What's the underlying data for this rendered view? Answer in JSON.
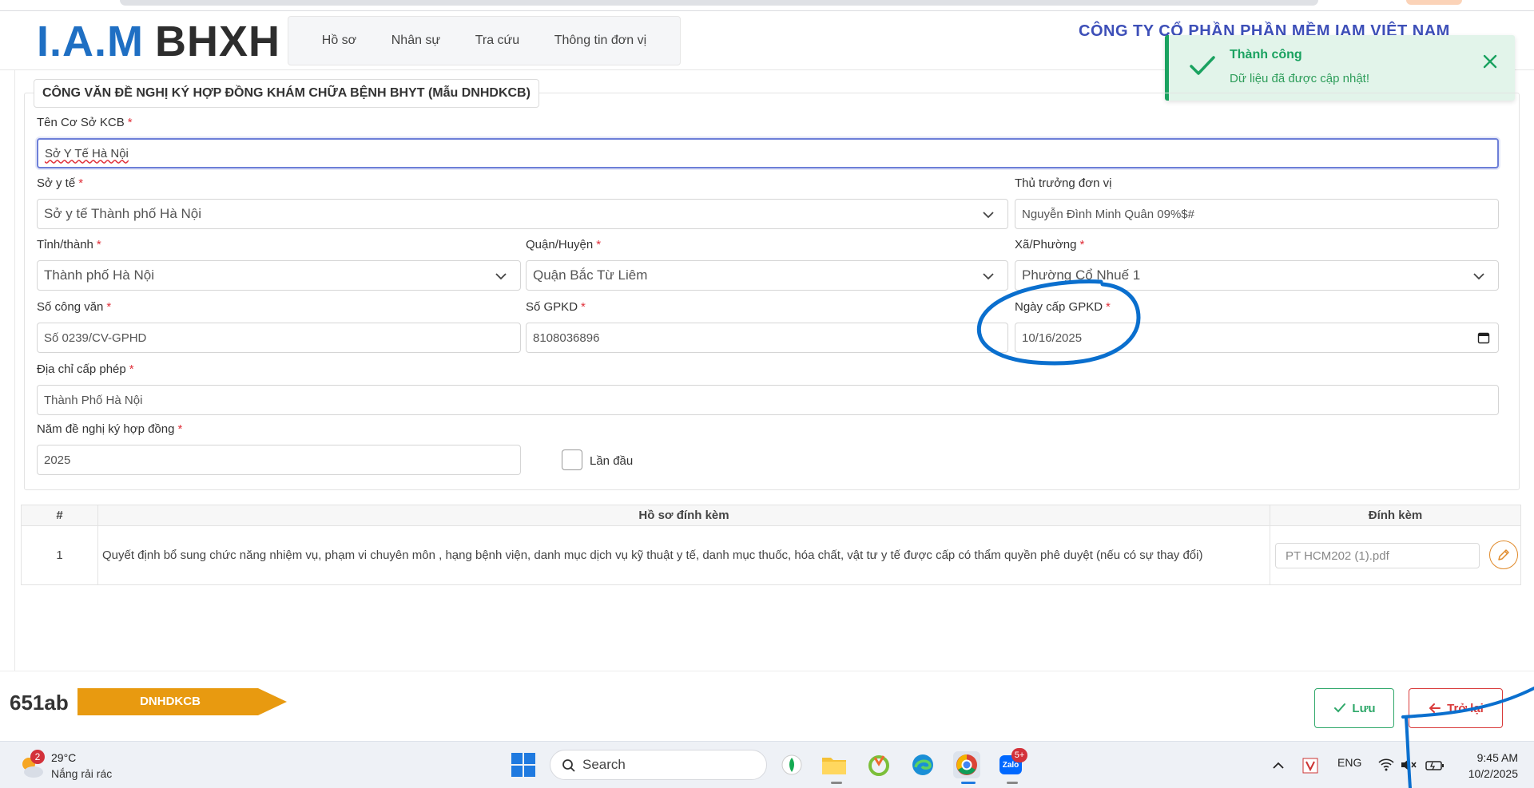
{
  "header": {
    "logo_iam": "I.A.M",
    "logo_bhxh": "BHXH",
    "nav": [
      "Hồ sơ",
      "Nhân sự",
      "Tra cứu",
      "Thông tin đơn vị"
    ],
    "company": "CÔNG TY CỔ PHẦN PHẦN MỀM IAM VIỆT NAM"
  },
  "toast": {
    "title": "Thành công",
    "message": "Dữ liệu đã được cập nhật!"
  },
  "form": {
    "legend": "CÔNG VĂN ĐỀ NGHỊ KÝ HỢP ĐỒNG KHÁM CHỮA BỆNH BHYT (Mẫu DNHDKCB)",
    "ten_co_so": {
      "label": "Tên Cơ Sở KCB",
      "value": "Sở Y Tế Hà Nội"
    },
    "so_y_te": {
      "label": "Sở y tế",
      "value": "Sở y tế Thành phố Hà Nội"
    },
    "thu_truong": {
      "label": "Thủ trưởng đơn vị",
      "value": "Nguyễn Đình Minh Quân 09%$#"
    },
    "tinh_thanh": {
      "label": "Tỉnh/thành",
      "value": "Thành phố Hà Nội"
    },
    "quan_huyen": {
      "label": "Quận/Huyện",
      "value": "Quận Bắc Từ Liêm"
    },
    "xa_phuong": {
      "label": "Xã/Phường",
      "value": "Phường Cổ Nhuế 1"
    },
    "so_cong_van": {
      "label": "Số công văn",
      "value": "Số 0239/CV-GPHD"
    },
    "so_gpkd": {
      "label": "Số GPKD",
      "value": "8108036896"
    },
    "ngay_cap": {
      "label": "Ngày cấp GPKD",
      "value": "10/16/2025"
    },
    "dia_chi": {
      "label": "Địa chỉ cấp phép",
      "value": "Thành Phố Hà Nội"
    },
    "nam_de_nghi": {
      "label": "Năm đề nghị ký hợp đồng",
      "value": "2025"
    },
    "lan_dau": {
      "label": "Lần đầu",
      "checked": false
    },
    "required_mark": "*"
  },
  "attachments": {
    "headers": [
      "#",
      "Hồ sơ đính kèm",
      "Đính kèm"
    ],
    "rows": [
      {
        "num": "1",
        "desc": "Quyết định bổ sung chức năng nhiệm vụ, phạm vi chuyên môn , hạng bệnh viện, danh mục dịch vụ kỹ thuật y tế, danh mục thuốc, hóa chất, vật tư y tế được cấp có thẩm quyền phê duyệt (nếu có sự thay đổi)",
        "file": "PT HCM202 (1).pdf"
      }
    ]
  },
  "footer": {
    "code": "651ab",
    "tag": "DNHDKCB",
    "save_label": "Lưu",
    "back_label": "Trở lại",
    "tag_color": "#e89a10"
  },
  "taskbar": {
    "weather_badge": "2",
    "temp": "29°C",
    "condition": "Nắng rải rác",
    "search": "Search",
    "lang": "ENG",
    "time": "9:45 AM",
    "date": "10/2/2025",
    "zalo_badge": "5+",
    "zalo_label": "Zalo"
  }
}
